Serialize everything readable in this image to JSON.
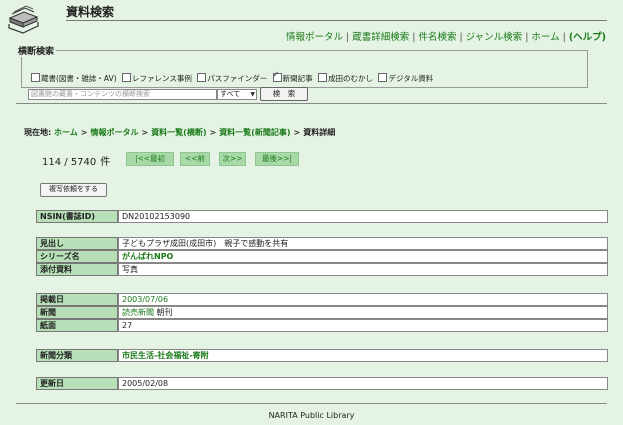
{
  "header": {
    "title": "資料検索"
  },
  "nav": [
    {
      "label": "情報ポータル"
    },
    {
      "label": "蔵書詳細検索"
    },
    {
      "label": "件名検索"
    },
    {
      "label": "ジャンル検索"
    },
    {
      "label": "ホーム"
    },
    {
      "label": "(ヘルプ)"
    }
  ],
  "cross_search": {
    "legend": "横断検索",
    "checkboxes": [
      {
        "label": "蔵書(図書・雑誌・AV)",
        "checked": false
      },
      {
        "label": "レファレンス事例",
        "checked": false
      },
      {
        "label": "パスファインダー",
        "checked": false
      },
      {
        "label": "新聞記事",
        "checked": true
      },
      {
        "label": "成田のむかし",
        "checked": false
      },
      {
        "label": "デジタル資料",
        "checked": false
      }
    ],
    "query_placeholder": "図書館の蔵書・コンテンツの横断検索",
    "scope_value": "すべて",
    "search_label": "検　索"
  },
  "breadcrumb": {
    "prefix": "現在地:",
    "items": [
      "ホーム",
      "情報ポータル",
      "資料一覧(横断)",
      "資料一覧(新聞記事)"
    ],
    "current": "資料詳細"
  },
  "pager": {
    "position": "114 / 5740",
    "unit": "件",
    "first": "|<<最初",
    "prev": "<<前",
    "next": "次>>",
    "last": "最後>>|"
  },
  "request_button": "複写依頼をする",
  "records": {
    "nsin": {
      "label": "NSIN(書誌ID)",
      "value": "DN20102153090"
    },
    "headline": {
      "label": "見出し",
      "value": "子どもプラザ成田(成田市)　親子で感動を共有"
    },
    "series": {
      "label": "シリーズ名",
      "value": "がんばれNPO"
    },
    "attached": {
      "label": "添付資料",
      "value": "写真"
    },
    "pubdate": {
      "label": "掲載日",
      "value": "2003/07/06"
    },
    "newspaper": {
      "label": "新聞",
      "value": "読売新聞",
      "extra": "朝刊"
    },
    "page": {
      "label": "紙面",
      "value": "27"
    },
    "category": {
      "label": "新聞分類",
      "value": "市民生活-社会福祉-寄附"
    },
    "updated": {
      "label": "更新日",
      "value": "2005/02/08"
    }
  },
  "footer": "NARITA Public Library"
}
